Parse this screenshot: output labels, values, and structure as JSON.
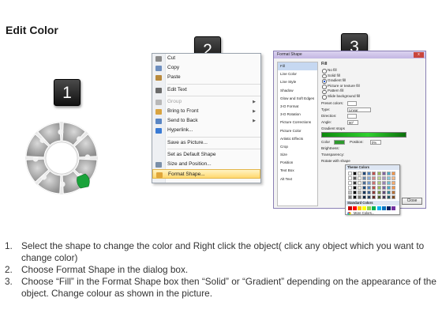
{
  "page": {
    "title": "Edit Color"
  },
  "steps": [
    "1",
    "2",
    "3"
  ],
  "context_menu": {
    "items": [
      {
        "label": "Cut",
        "icon": "scissors-icon",
        "color": "#8a8a8a"
      },
      {
        "label": "Copy",
        "icon": "copy-icon",
        "color": "#6e8fbf"
      },
      {
        "label": "Paste",
        "icon": "paste-icon",
        "color": "#b98a3e"
      },
      {
        "label": "Edit Text",
        "icon": "text-box-icon",
        "color": "#6b6b6b",
        "separator_before": true
      },
      {
        "label": "Group",
        "icon": "group-icon",
        "color": "#b8b8b8",
        "disabled": true,
        "separator_before": true,
        "submenu": true
      },
      {
        "label": "Bring to Front",
        "icon": "bring-to-front-icon",
        "color": "#d9a441",
        "submenu": true
      },
      {
        "label": "Send to Back",
        "icon": "send-to-back-icon",
        "color": "#5a86c4",
        "submenu": true
      },
      {
        "label": "Hyperlink...",
        "icon": "hyperlink-icon",
        "color": "#3a7bd5"
      },
      {
        "label": "Save as Picture...",
        "icon": "",
        "color": "",
        "separator_before": true
      },
      {
        "label": "Set as Default Shape",
        "icon": "",
        "color": "",
        "separator_before": true
      },
      {
        "label": "Size and Position...",
        "icon": "size-position-icon",
        "color": "#7a8fa8"
      },
      {
        "label": "Format Shape...",
        "icon": "format-shape-icon",
        "color": "#e0a63a",
        "highlighted": true
      }
    ]
  },
  "format_dialog": {
    "title": "Format Shape",
    "close_glyph": "x",
    "nav": [
      "Fill",
      "Line Color",
      "Line Style",
      "Shadow",
      "Glow and Soft Edges",
      "3-D Format",
      "3-D Rotation",
      "Picture Corrections",
      "Picture Color",
      "Artistic Effects",
      "Crop",
      "Size",
      "Position",
      "Text Box",
      "Alt Text"
    ],
    "active_nav": "Fill",
    "heading": "Fill",
    "fill_options": [
      "No fill",
      "Solid fill",
      "Gradient fill",
      "Picture or texture fill",
      "Pattern fill",
      "Slide background fill"
    ],
    "selected_option": "Gradient fill",
    "preset_label": "Preset colors:",
    "type_label": "Type:",
    "type_value": "Linear",
    "direction_label": "Direction:",
    "angle_label": "Angle:",
    "angle_value": "90°",
    "stops_label": "Gradient stops",
    "color_label": "Color",
    "position_label": "Position:",
    "position_value": "0%",
    "brightness_label": "Brightness:",
    "transparency_label": "Transparency:",
    "rotate_label": "Rotate with shape",
    "close_button": "Close"
  },
  "palette": {
    "theme_label": "Theme Colors",
    "standard_label": "Standard Colors",
    "more_label": "More Colors...",
    "theme_colors": [
      "#ffffff",
      "#000000",
      "#eeece1",
      "#1f497d",
      "#4f81bd",
      "#c0504d",
      "#9bbb59",
      "#8064a2",
      "#4bacc6",
      "#f79646"
    ],
    "standard_colors": [
      "#c00000",
      "#ff0000",
      "#ffc000",
      "#ffff00",
      "#92d050",
      "#00b050",
      "#00b0f0",
      "#0070c0",
      "#002060",
      "#7030a0"
    ]
  },
  "instructions": [
    {
      "num": "1.",
      "text": "Select the shape to change the color and Right click the object( click any object which you want to change color)"
    },
    {
      "num": "2.",
      "text": "Choose Format Shape in the dialog box."
    },
    {
      "num": "3.",
      "text": "Choose “Fill” in the Format Shape box then “Solid” or “Gradient” depending on the appearance of the object. Change colour as shown in the picture."
    }
  ]
}
